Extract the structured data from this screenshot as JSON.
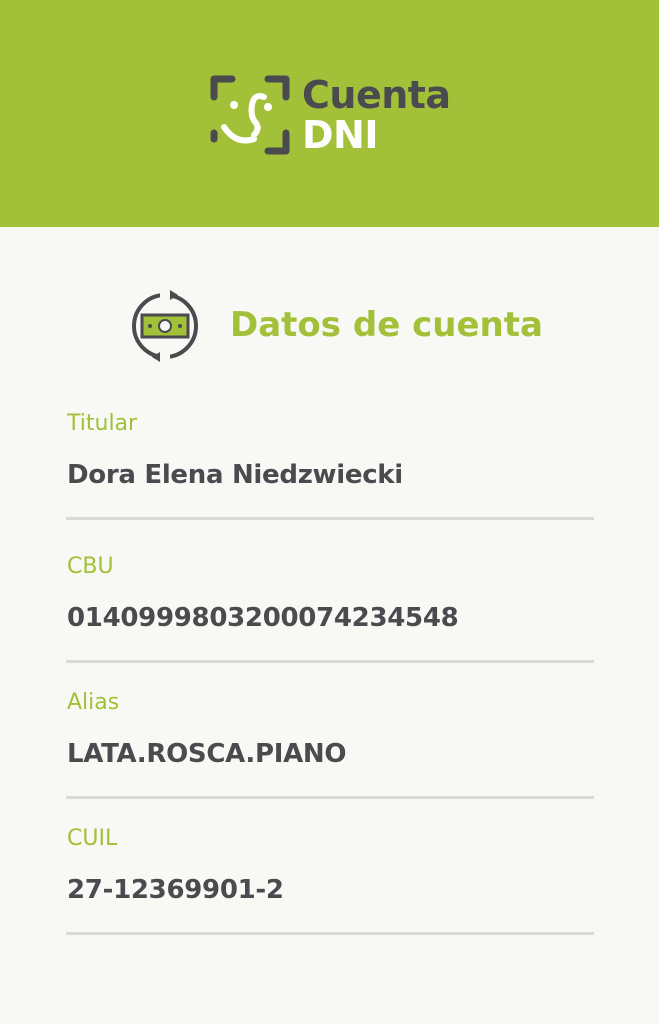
{
  "header": {
    "brand_line1": "Cuenta",
    "brand_line2": "DNI",
    "background_color": "#a2c038",
    "logo_icon": "face-scan-icon"
  },
  "section": {
    "title": "Datos de cuenta",
    "icon": "money-exchange-icon",
    "accent_color": "#a2c038"
  },
  "fields": [
    {
      "label": "Titular",
      "value": "Dora Elena Niedzwiecki"
    },
    {
      "label": "CBU",
      "value": "0140999803200074234548"
    },
    {
      "label": "Alias",
      "value": "LATA.ROSCA.PIANO"
    },
    {
      "label": "CUIL",
      "value": "27-12369901-2"
    }
  ]
}
